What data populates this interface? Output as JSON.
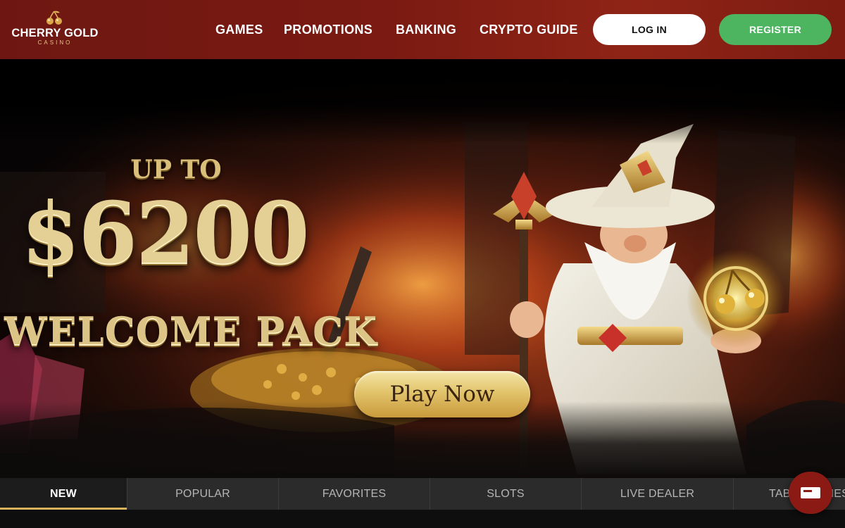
{
  "header": {
    "logo_text": "CHERRY GOLD",
    "logo_subtext": "CASINO",
    "nav": [
      {
        "label": "GAMES"
      },
      {
        "label": "PROMOTIONS"
      },
      {
        "label": "BANKING"
      },
      {
        "label": "CRYPTO GUIDE"
      }
    ],
    "login_label": "LOG IN",
    "register_label": "REGISTER"
  },
  "hero": {
    "up_to": "UP TO",
    "amount": "$6200",
    "pack": "WELCOME PACK",
    "play_label": "Play Now"
  },
  "tabs": [
    {
      "label": "NEW",
      "active": true
    },
    {
      "label": "POPULAR"
    },
    {
      "label": "FAVORITES"
    },
    {
      "label": "SLOTS"
    },
    {
      "label": "LIVE DEALER"
    },
    {
      "label": "TABLE GAMES"
    }
  ],
  "colors": {
    "header": "#7a1a12",
    "register": "#4db560",
    "gold": "#e4cf95",
    "tab_active_underline": "#d8b25a"
  },
  "icons": {
    "logo": "cherry-icon",
    "chat": "chat-icon"
  }
}
